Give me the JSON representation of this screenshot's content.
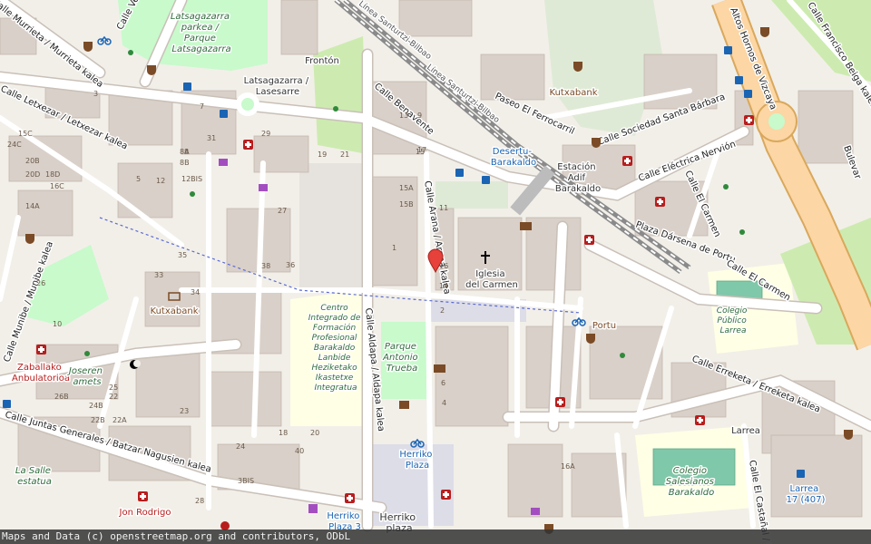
{
  "attribution": "Maps and Data (c) openstreetmap.org and contributors, ODbL",
  "streets": {
    "murrieta": "Calle Murrieta / Murrieta kalea",
    "vega": "Calle Vega",
    "letxezar": "Calle Letxezar / Letxezar kalea",
    "munibe": "Calle Munibe / Munibe kalea",
    "juntas": "Calle Juntas Generales / Batzar Nagusien kalea",
    "benavente": "Calle Benavente",
    "arana": "Calle Arana / Arana kalea",
    "aldapa": "Calle Aldapa / Aldapa kalea",
    "paseo_ferrocarril": "Paseo El Ferrocarril",
    "santa_barbara": "Calle Sociedad Santa Bárbara",
    "electrica": "Calle Eléctrica Nervión",
    "darsena": "Plaza Dársena de Portu",
    "carmen_e": "Calle El Carmen",
    "carmen_w": "Calle El Carmen",
    "erreketa": "Calle Erreketa / Erreketa kalea",
    "castanal": "Calle El Castañal / El C",
    "altos": "Altos Hornos de Vizcaya",
    "beiga": "Calle Francisco Beiga kalea",
    "bulevar": "Bulevar"
  },
  "places": {
    "latsagazarra_parkea": [
      "Latsagazarra",
      "parkea /",
      "Parque",
      "Latsagazarra"
    ],
    "latsagazarra_lasesarre": [
      "Latsagazarra /",
      "Lasesarre"
    ],
    "fronton": "Frontón",
    "kutxabank_ne": "Kutxabank",
    "kutxabank_w": "Kutxabank",
    "desertu": [
      "Desertu-",
      "Barakaldo"
    ],
    "estacion": [
      "Estación",
      "Adif",
      "Barakaldo"
    ],
    "iglesia": [
      "Iglesia",
      "del Carmen"
    ],
    "centro": [
      "Centro",
      "Integrado de",
      "Formación",
      "Profesional",
      "Barakaldo",
      "Lanbide",
      "Heziketako",
      "Ikastetxe",
      "Integratua"
    ],
    "parque_trueba": [
      "Parque",
      "Antonio",
      "Trueba"
    ],
    "colegio_larrea": [
      "Colegio",
      "Público",
      "Larrea"
    ],
    "larrea": "Larrea",
    "larrea_stop": [
      "Larrea",
      "17 (407)"
    ],
    "colegio_salesianos": [
      "Colegio",
      "Salesianos",
      "Barakaldo"
    ],
    "zaballako": [
      "Zaballako",
      "Anbulatorioa"
    ],
    "joseren": [
      "Joseren",
      "amets"
    ],
    "la_salle": [
      "La Salle",
      "estatua"
    ],
    "jon_rodrigo": "Jon Rodrigo",
    "herriko_plaza_blue": [
      "Herriko",
      "Plaza"
    ],
    "herriko_plaza3": [
      "Herriko",
      "Plaza 3"
    ],
    "herriko_plaza": [
      "Herriko",
      "plaza"
    ],
    "portu": "Portu",
    "rail_line": "Línea Santurtzi-Bilbao",
    "rail_line2": "Línea Santurtzi-Bilbao"
  },
  "house_numbers": {
    "list": [
      "3",
      "5",
      "7",
      "9",
      "11",
      "13",
      "15",
      "17",
      "19",
      "21",
      "2",
      "4",
      "6",
      "8",
      "10",
      "12",
      "14",
      "16",
      "18",
      "20",
      "22",
      "24",
      "26",
      "28",
      "29",
      "31",
      "33",
      "34",
      "35",
      "36",
      "38",
      "40",
      "15A",
      "15B",
      "15C",
      "16C",
      "18D",
      "20B",
      "20D",
      "24C",
      "14A",
      "12BIS",
      "3BIS",
      "26B",
      "24B",
      "22B",
      "22A",
      "8A",
      "8B",
      "16A",
      "1",
      "25",
      "27",
      "23"
    ]
  },
  "colors": {
    "land": "#f2efe9",
    "building": "#d9d0c9",
    "road": "#ffffff",
    "road_casing": "#c9c0b8",
    "park": "#c8facc",
    "school": "#ffffe5",
    "rail": "#999999",
    "highway": "#fcd6a4",
    "highway_casing": "#d9a85c",
    "pedestrian": "#dddde8",
    "water_blue": "#1a64b4",
    "red": "#b81d1d",
    "brown": "#7a4b26",
    "marker": "#e7413b"
  },
  "icons": [
    "cafe-icon",
    "bus-stop-icon",
    "bicycle-icon",
    "hospital-icon",
    "pharmacy-icon",
    "post-icon",
    "bank-icon",
    "church-icon",
    "playground-icon",
    "shop-icon",
    "library-icon",
    "cross-icon",
    "fuel-icon",
    "map-pin-icon"
  ]
}
